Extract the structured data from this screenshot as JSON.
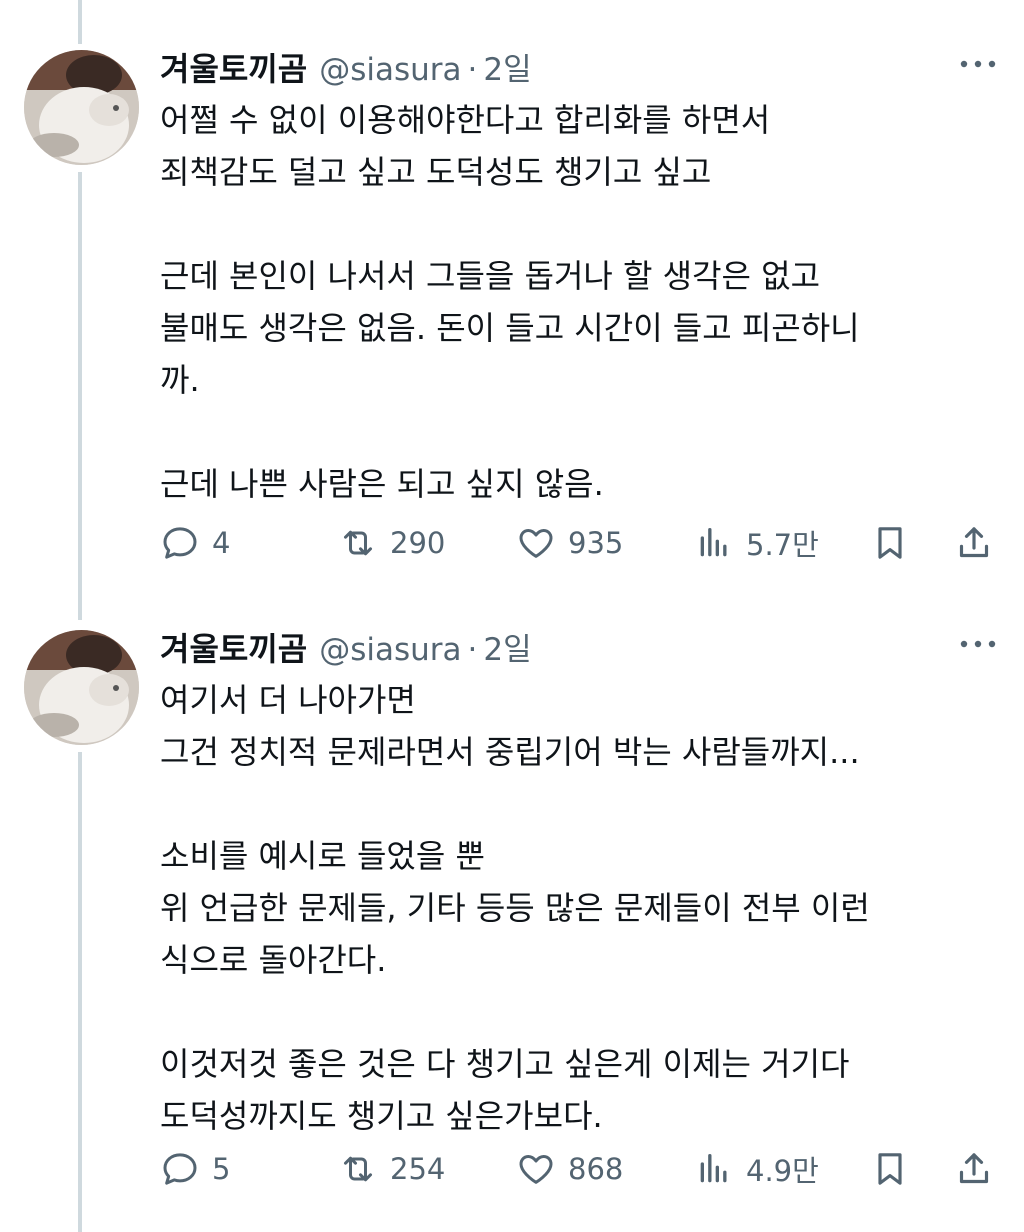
{
  "tweets": [
    {
      "name": "겨울토끼곰",
      "handle": "@siasura",
      "dot": "·",
      "time": "2일",
      "text": "어쩔 수 없이 이용해야한다고 합리화를 하면서\n죄책감도 덜고 싶고 도덕성도 챙기고 싶고\n\n근데 본인이 나서서 그들을 돕거나 할 생각은 없고\n불매도 생각은 없음. 돈이 들고 시간이 들고 피곤하니\n까.\n\n근데 나쁜 사람은 되고 싶지 않음.",
      "replies": "4",
      "retweets": "290",
      "likes": "935",
      "views": "5.7만"
    },
    {
      "name": "겨울토끼곰",
      "handle": "@siasura",
      "dot": "·",
      "time": "2일",
      "text": "여기서 더 나아가면\n그건 정치적 문제라면서 중립기어 박는 사람들까지...\n\n소비를 예시로 들었을 뿐\n위 언급한 문제들, 기타 등등 많은 문제들이 전부 이런\n식으로 돌아간다.\n\n이것저것 좋은 것은 다 챙기고 싶은게 이제는 거기다\n도덕성까지도 챙기고 싶은가보다.",
      "replies": "5",
      "retweets": "254",
      "likes": "868",
      "views": "4.9만"
    }
  ],
  "icons": {
    "reply": "reply-icon",
    "retweet": "retweet-icon",
    "like": "heart-icon",
    "views": "views-icon",
    "bookmark": "bookmark-icon",
    "share": "share-icon",
    "more": "more-icon"
  },
  "colors": {
    "text": "#0f1419",
    "secondary": "#536471",
    "thread_line": "#cfd9de"
  }
}
